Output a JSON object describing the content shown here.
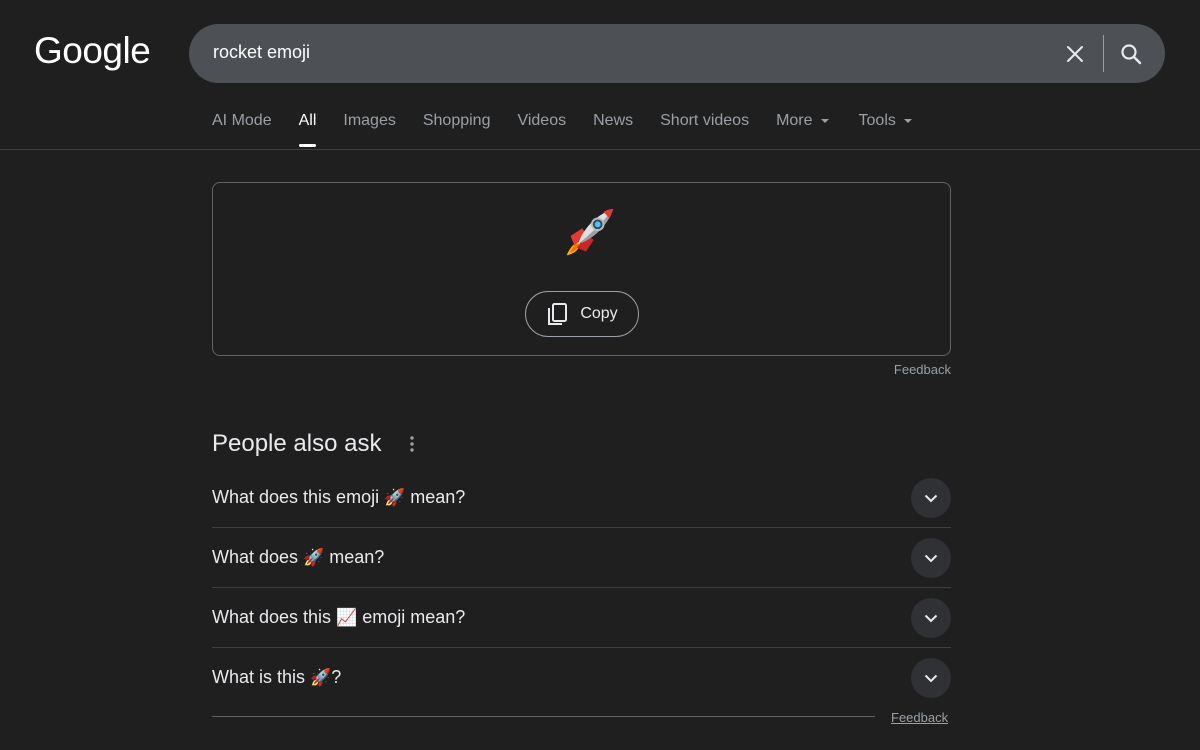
{
  "header": {
    "logo_text": "Google",
    "search": {
      "value": "rocket emoji",
      "clear_icon": "close-icon",
      "search_icon": "search-icon"
    }
  },
  "tabs": [
    {
      "label": "AI Mode",
      "active": false
    },
    {
      "label": "All",
      "active": true
    },
    {
      "label": "Images",
      "active": false
    },
    {
      "label": "Shopping",
      "active": false
    },
    {
      "label": "Videos",
      "active": false
    },
    {
      "label": "News",
      "active": false
    },
    {
      "label": "Short videos",
      "active": false
    },
    {
      "label": "More",
      "active": false,
      "dropdown": true
    },
    {
      "label": "Tools",
      "active": false,
      "dropdown": true
    }
  ],
  "emoji_card": {
    "emoji_icon": "rocket-icon",
    "copy_label": "Copy",
    "copy_icon": "copy-icon",
    "feedback_label": "Feedback"
  },
  "people_also_ask": {
    "title": "People also ask",
    "menu_icon": "more-vert-icon",
    "questions": [
      {
        "before": "What does this emoji ",
        "emoji": "🚀",
        "after": " mean?"
      },
      {
        "before": "What does ",
        "emoji": "🚀",
        "after": " mean?"
      },
      {
        "before": "What does this ",
        "emoji": "📈",
        "after": " emoji mean?"
      },
      {
        "before": "What is this ",
        "emoji": "🚀",
        "after": "?"
      }
    ],
    "feedback_label": "Feedback"
  },
  "colors": {
    "background": "#1f1f1f",
    "search_bg": "#4d5156",
    "text": "#e8eaed",
    "muted": "#9aa0a6",
    "border": "#5f6368"
  }
}
